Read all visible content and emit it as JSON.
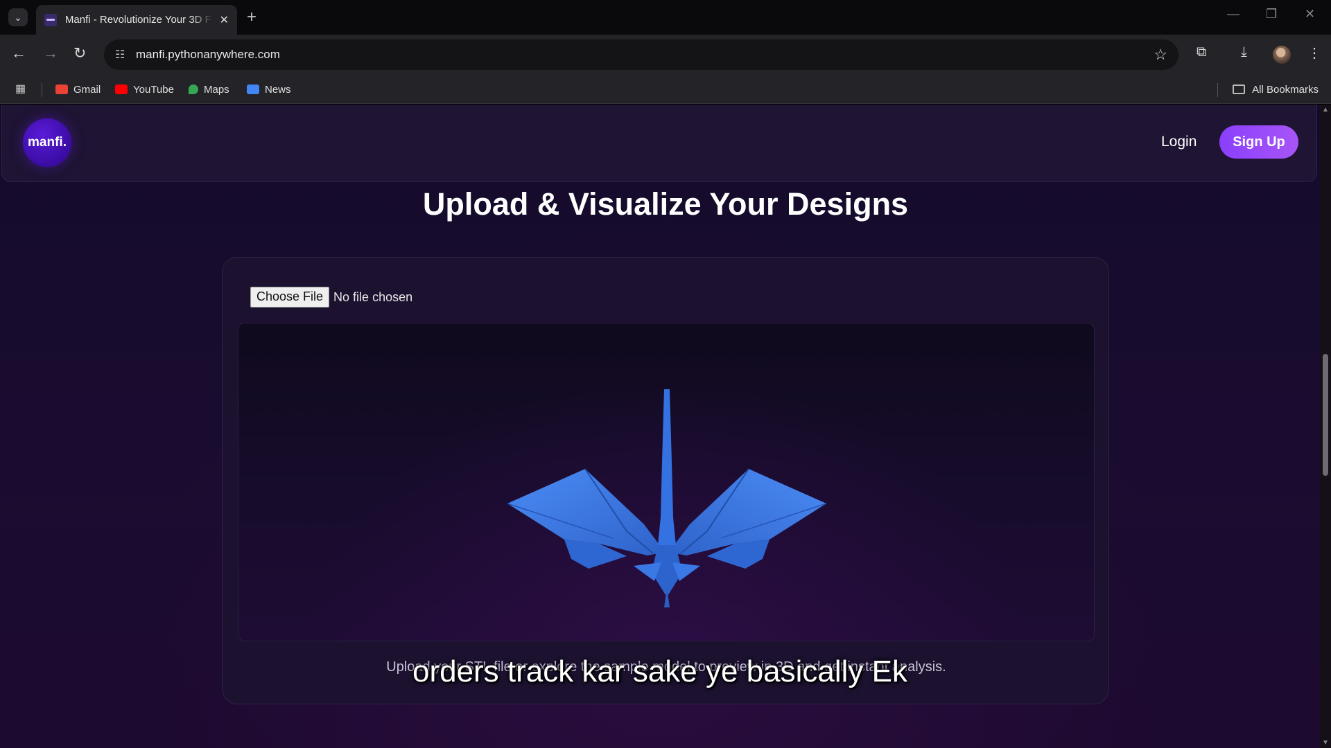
{
  "browser": {
    "tab_title": "Manfi - Revolutionize Your 3D F",
    "tab_close": "✕",
    "new_tab": "+",
    "url": "manfi.pythonanywhere.com",
    "bookmarks": [
      {
        "label": "Gmail",
        "icon": "gmail-icon",
        "color": "#ea4335"
      },
      {
        "label": "YouTube",
        "icon": "youtube-icon",
        "color": "#ff0000"
      },
      {
        "label": "Maps",
        "icon": "maps-icon",
        "color": "#34a853"
      },
      {
        "label": "News",
        "icon": "news-icon",
        "color": "#4285f4"
      }
    ],
    "all_bookmarks": "All Bookmarks"
  },
  "site": {
    "logo": "manfi.",
    "login": "Login",
    "signup": "Sign Up",
    "title": "Upload & Visualize Your Designs",
    "choose_file": "Choose File",
    "no_file": "No file chosen",
    "upload_note": "Upload your STL file or explore the sample model to preview in 3D and get instant analysis.",
    "accent_color": "#a855f7",
    "model_color": "#3b7be8"
  },
  "overlay": {
    "subtitle": "orders track kar sake ye basically Ek"
  }
}
